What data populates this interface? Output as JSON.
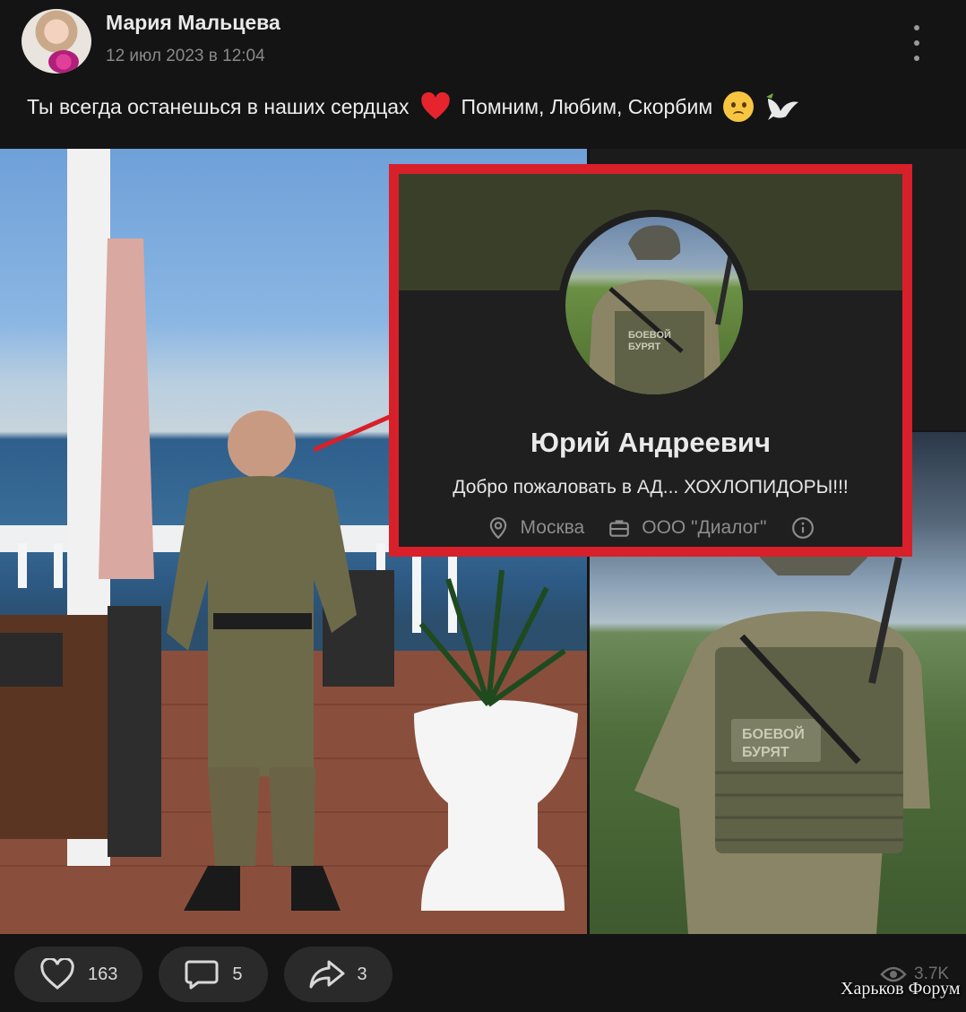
{
  "post": {
    "author": "Мария Мальцева",
    "date": "12 июл 2023 в 12:04",
    "text_part1": "Ты всегда останешься в наших сердцах",
    "text_part2": "Помним, Любим, Скорбим",
    "menu_icon": "more-vertical-icon"
  },
  "profile_card": {
    "name": "Юрий Андреевич",
    "status": "Добро пожаловать в АД... ХОХЛОПИДОРЫ!!!",
    "location": "Москва",
    "work": "ООО \"Диалог\"",
    "border_color": "#d8202a",
    "cover_color": "#3a3f2a"
  },
  "photo_labels": {
    "patch_line1": "БОЕВОЙ",
    "patch_line2": "БУРЯТ"
  },
  "actions": {
    "likes": "163",
    "comments": "5",
    "shares": "3"
  },
  "views": "3.7K",
  "watermark": "Харьков Форум"
}
